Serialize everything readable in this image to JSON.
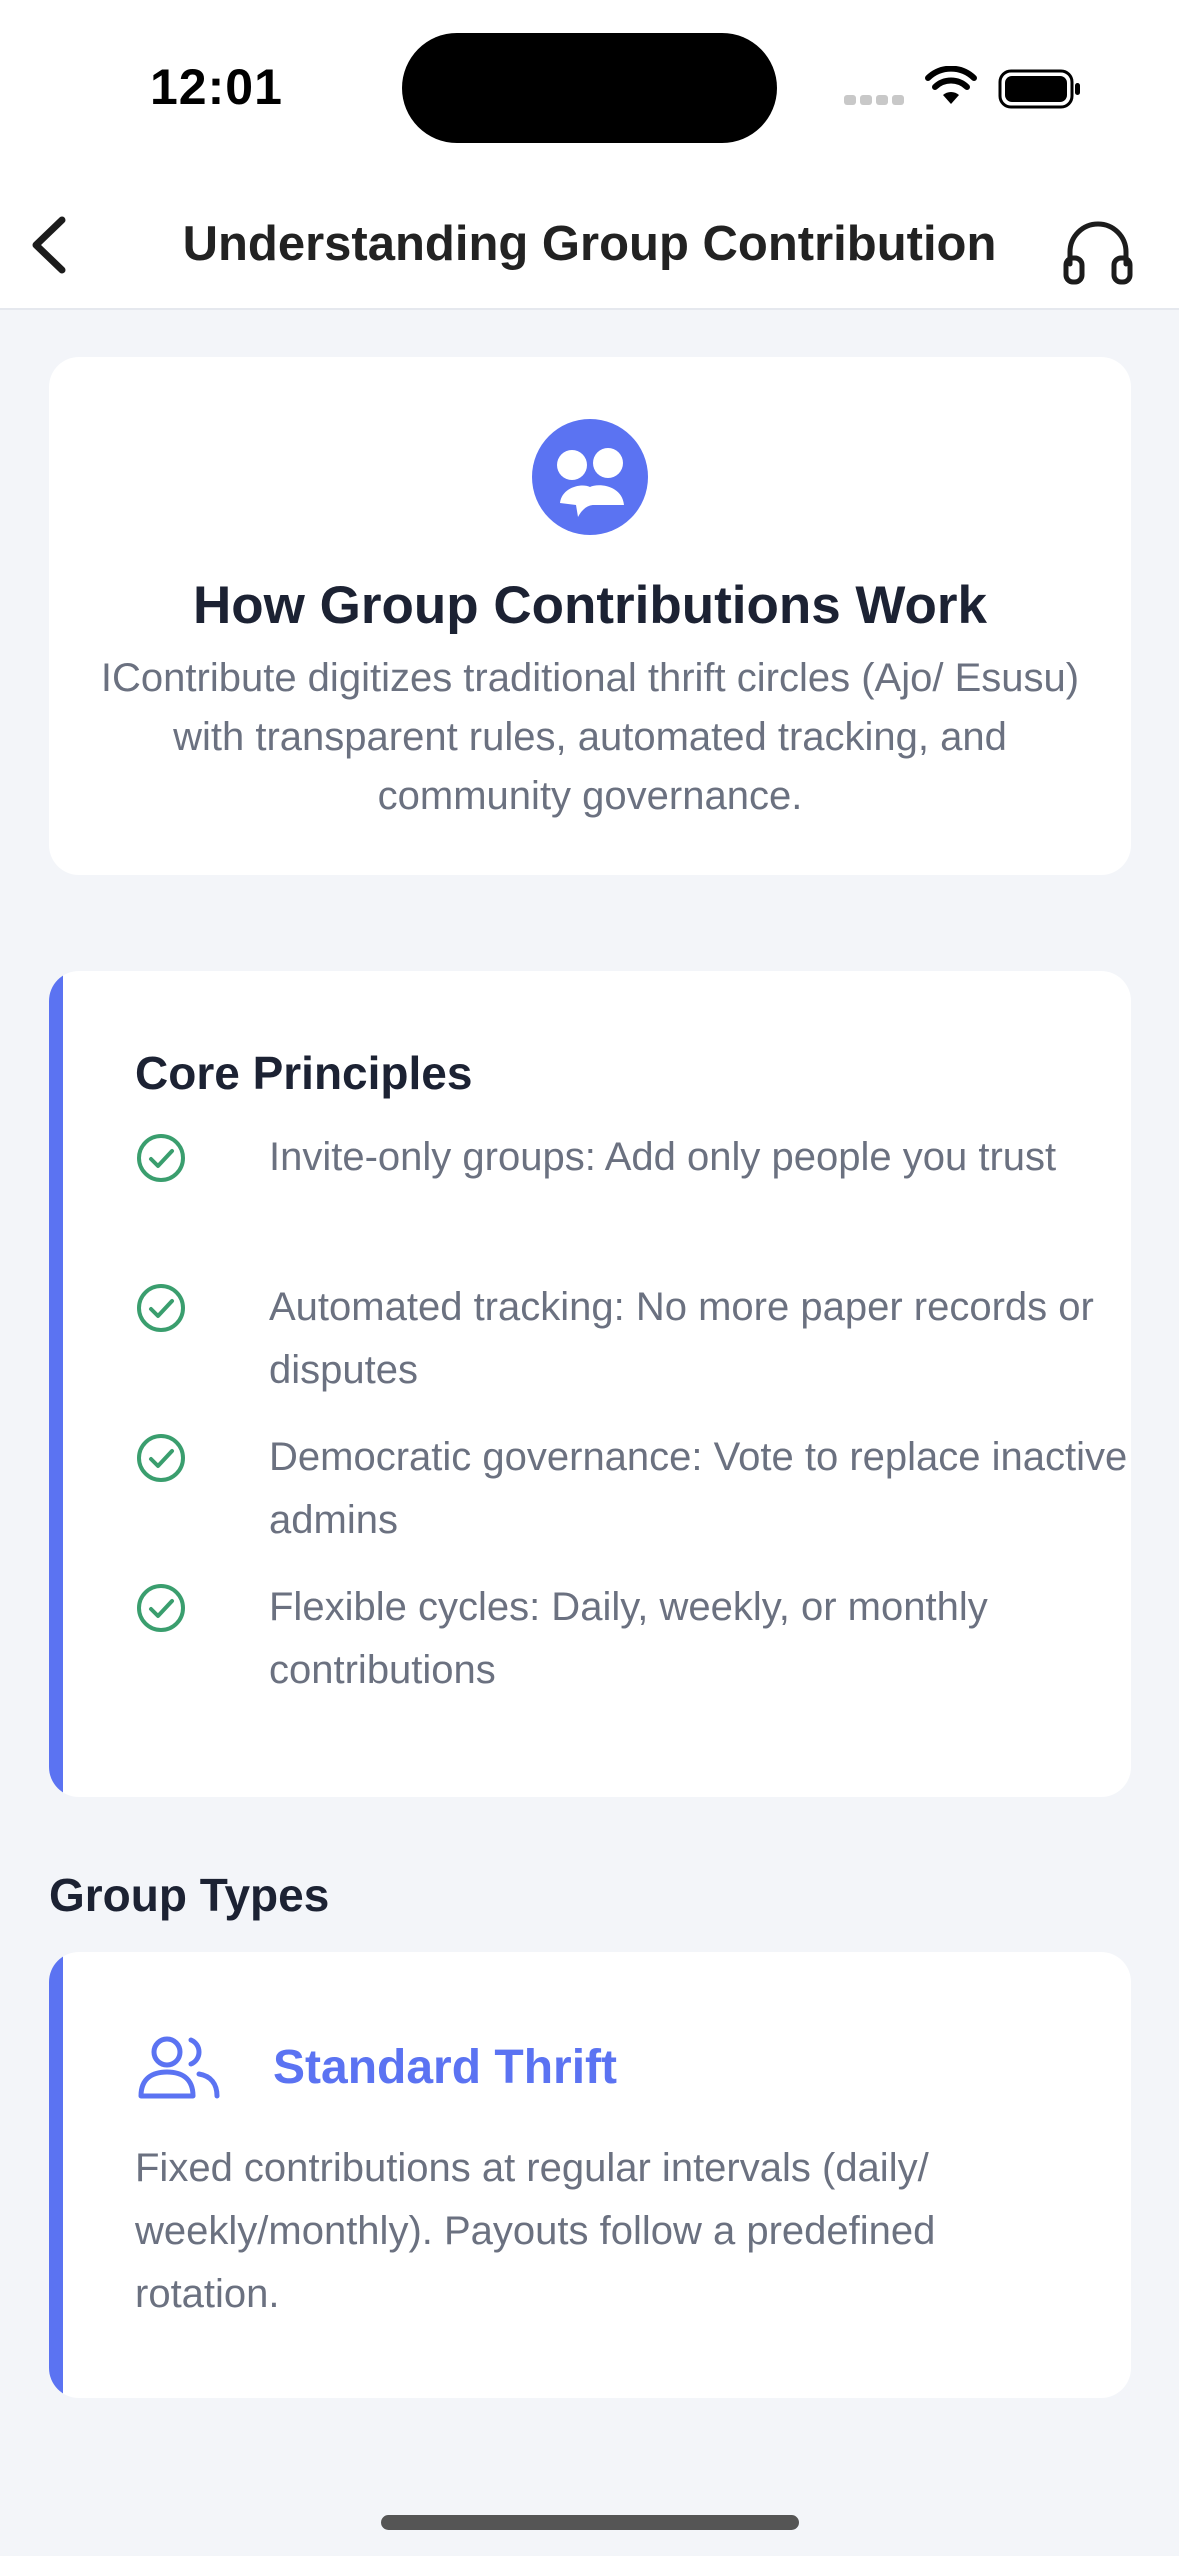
{
  "status_bar": {
    "time": "12:01"
  },
  "nav": {
    "title": "Understanding Group Contribution",
    "back_icon": "chevron-left-icon",
    "support_icon": "headphones-icon"
  },
  "intro": {
    "icon": "group-chat-icon",
    "title": "How Group Contributions Work",
    "description": "IContribute digitizes traditional thrift circles (Ajo/ Esusu) with transparent rules, automated tracking, and community governance."
  },
  "principles": {
    "title": "Core Principles",
    "items": [
      {
        "text": "Invite-only groups: Add only people you trust"
      },
      {
        "text": "Automated tracking: No more paper records or disputes"
      },
      {
        "text": "Democratic governance: Vote to replace inactive admins"
      },
      {
        "text": "Flexible cycles: Daily, weekly, or monthly contributions"
      }
    ]
  },
  "group_types": {
    "title": "Group Types",
    "items": [
      {
        "icon": "people-icon",
        "name": "Standard Thrift",
        "description": "Fixed contributions at regular intervals (daily/ weekly/monthly). Payouts follow a predefined rotation."
      }
    ]
  },
  "colors": {
    "accent": "#5b73f2",
    "check": "#3a9e6e",
    "text_primary": "#1c2233",
    "text_secondary": "#6b7180",
    "background": "#f3f5f9"
  }
}
